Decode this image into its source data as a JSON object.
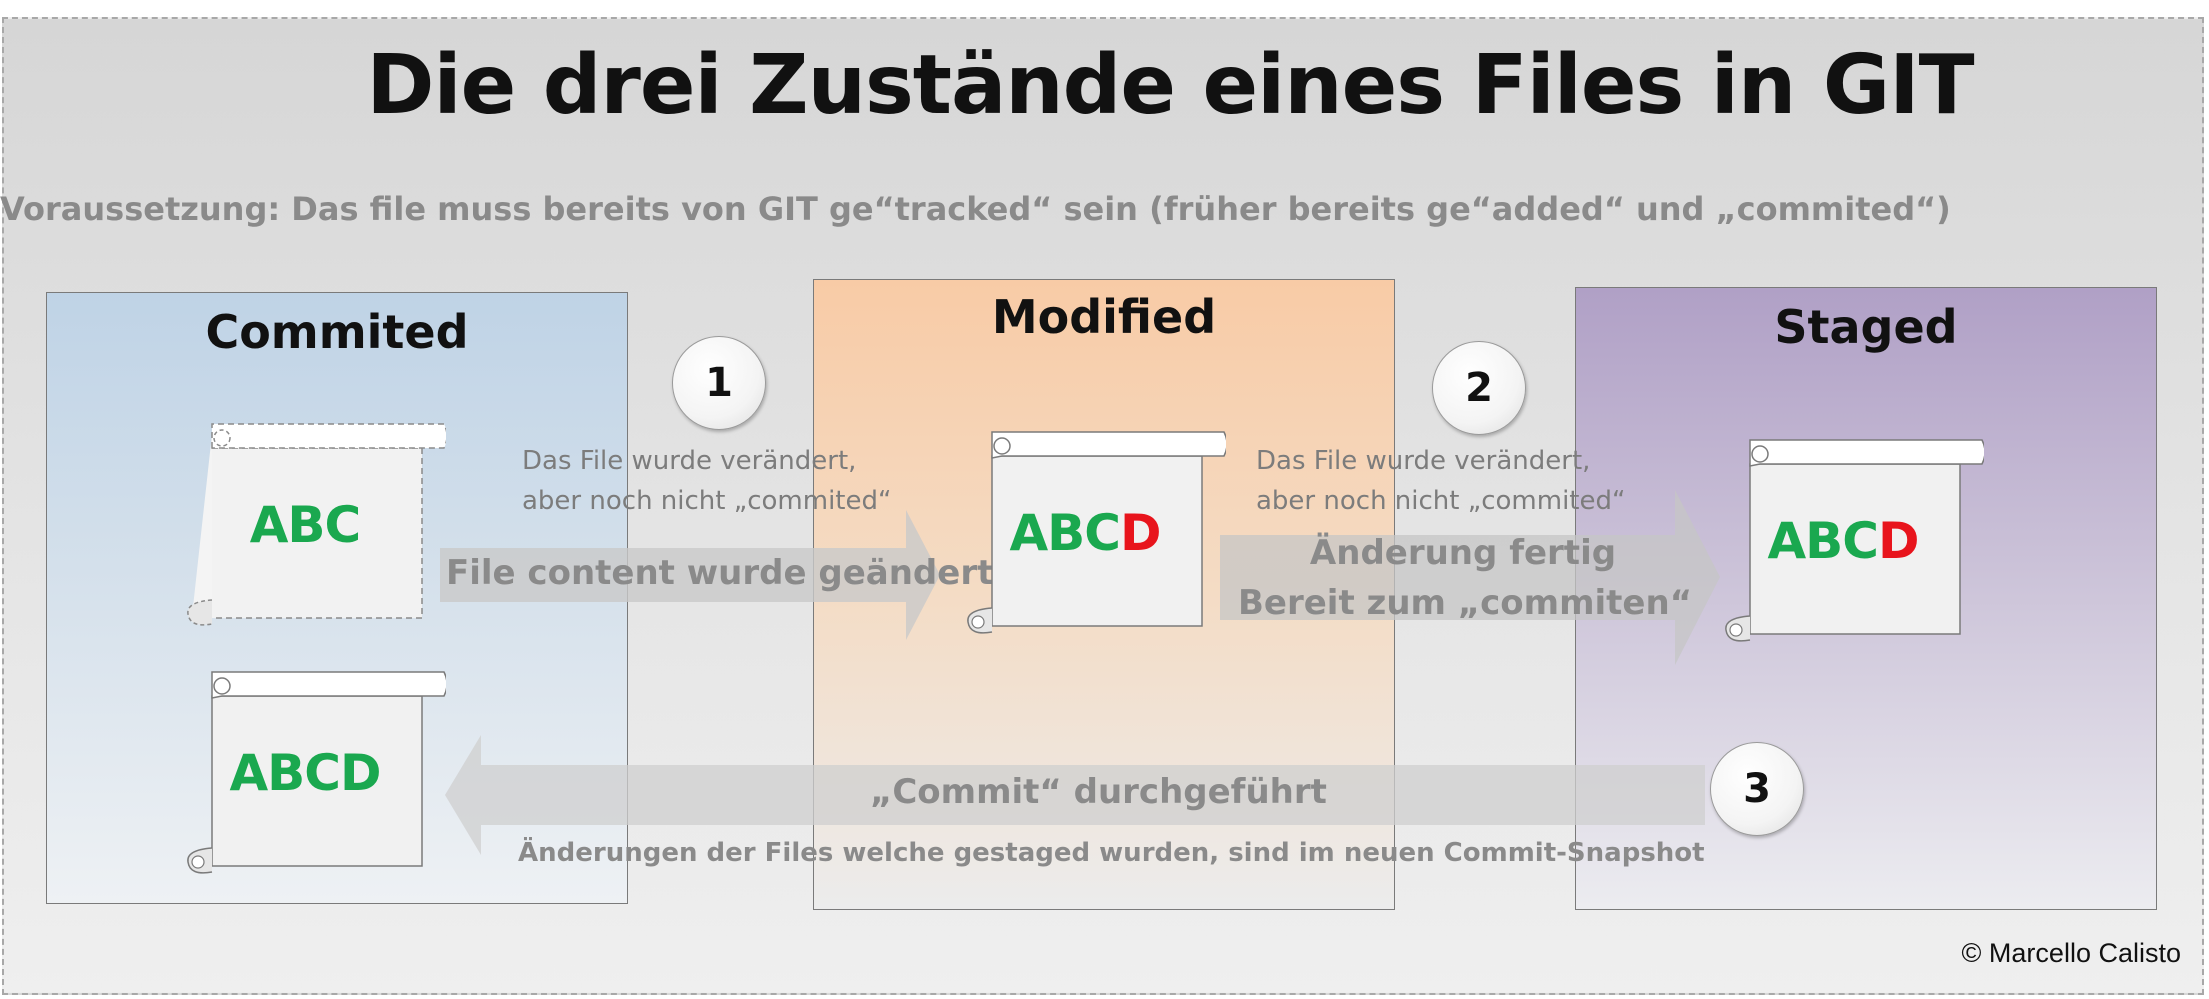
{
  "title": "Die drei Zustände eines Files in GIT",
  "subtitle": "Voraussetzung: Das file muss bereits von GIT ge“tracked“ sein (früher bereits ge“added“ und „commited“)",
  "states": {
    "commited": "Commited",
    "modified": "Modified",
    "staged": "Staged"
  },
  "files": {
    "commited_old": {
      "text": "ABC",
      "suffix": ""
    },
    "commited_new": {
      "text": "ABCD",
      "suffix": ""
    },
    "modified": {
      "text": "ABC",
      "suffix": "D"
    },
    "staged": {
      "text": "ABC",
      "suffix": "D"
    }
  },
  "steps": {
    "s1": {
      "number": "1",
      "note_line1": "Das File wurde verändert,",
      "note_line2": "aber noch nicht „commited“",
      "arrow_label": "File content wurde geändert"
    },
    "s2": {
      "number": "2",
      "note_line1": "Das File wurde verändert,",
      "note_line2": "aber noch nicht „commited“",
      "arrow_line1": "Änderung fertig",
      "arrow_line2": "Bereit zum „commiten“"
    },
    "s3": {
      "number": "3",
      "arrow_label": "„Commit“ durchgeführt",
      "note": "Änderungen der Files welche gestaged wurden, sind im neuen Commit-Snapshot"
    }
  },
  "colors": {
    "file_text": "#1aa84f",
    "change_text": "#e8141c",
    "commited_fill": "#bfd3e6",
    "modified_fill": "#f8cba6",
    "staged_fill": "#b0a0c6",
    "arrow_fill": "#c8c8c8"
  },
  "copyright": "© Marcello Calisto"
}
